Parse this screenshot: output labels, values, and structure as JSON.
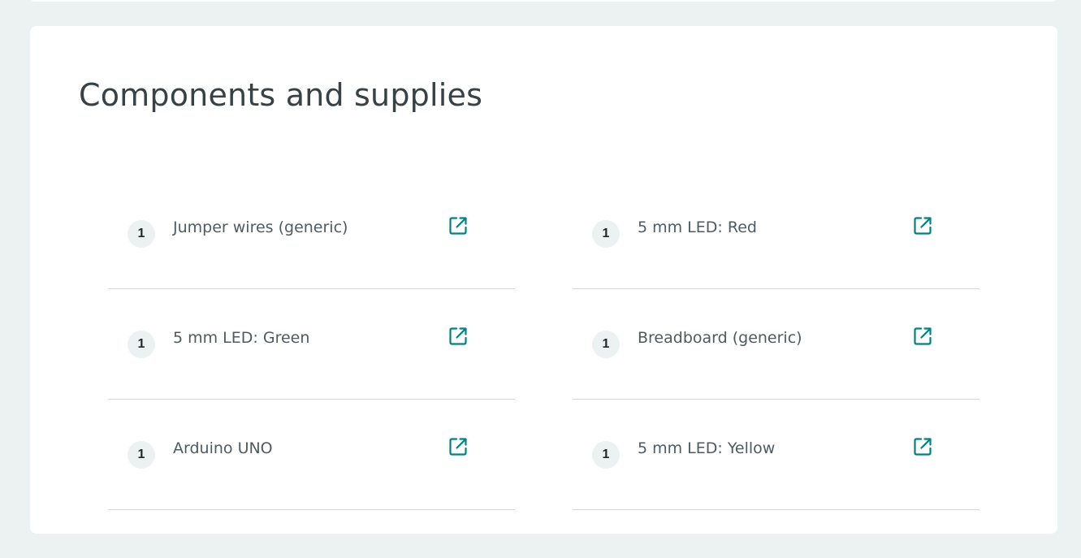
{
  "section": {
    "title": "Components and supplies"
  },
  "colors": {
    "page_background": "#ECF1F1",
    "card_background": "#FFFFFF",
    "accent_teal": "#008184",
    "divider": "#D4D8D9",
    "text_primary": "#374146"
  },
  "components": [
    {
      "qty": "1",
      "name": "Jumper wires (generic)",
      "icon": "external-link-icon"
    },
    {
      "qty": "1",
      "name": "5 mm LED: Red",
      "icon": "external-link-icon"
    },
    {
      "qty": "1",
      "name": "5 mm LED: Green",
      "icon": "external-link-icon"
    },
    {
      "qty": "1",
      "name": "Breadboard (generic)",
      "icon": "external-link-icon"
    },
    {
      "qty": "1",
      "name": "Arduino UNO",
      "icon": "external-link-icon"
    },
    {
      "qty": "1",
      "name": "5 mm LED: Yellow",
      "icon": "external-link-icon"
    }
  ]
}
